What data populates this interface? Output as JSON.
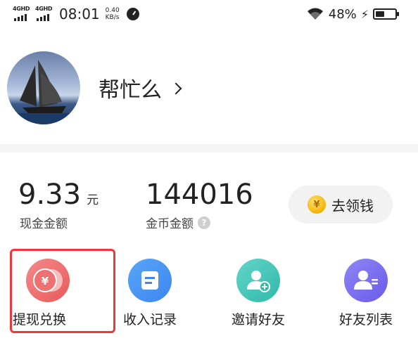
{
  "status_bar": {
    "network_1": "4GHD",
    "network_2": "4GHD",
    "time": "08:01",
    "speed_value": "0.40",
    "speed_unit": "KB/s",
    "battery_percent": "48%",
    "battery_level": 0.48
  },
  "profile": {
    "username": "帮忙么"
  },
  "balances": {
    "cash_value": "9.33",
    "cash_unit": "元",
    "cash_label": "现金金额",
    "coin_value": "144016",
    "coin_label": "金币金额",
    "help_icon_glyph": "?"
  },
  "get_money": {
    "icon_glyph": "¥",
    "label": "去领钱"
  },
  "actions": [
    {
      "label": "提现兑换",
      "icon": "yuan-coins-icon",
      "color": "#e95a5a"
    },
    {
      "label": "收入记录",
      "icon": "document-icon",
      "color": "#3b86ef"
    },
    {
      "label": "邀请好友",
      "icon": "add-user-icon",
      "color": "#2fb9a9"
    },
    {
      "label": "好友列表",
      "icon": "user-list-icon",
      "color": "#6a5be8"
    }
  ],
  "highlight_color": "#e63b3b"
}
